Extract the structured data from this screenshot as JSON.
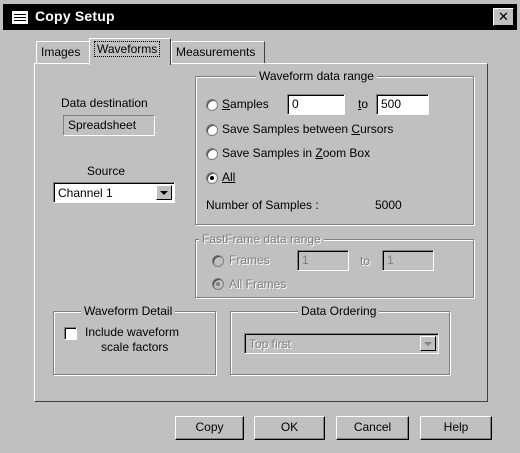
{
  "window": {
    "title": "Copy Setup",
    "close_glyph": "✕"
  },
  "tabs": [
    "Images",
    "Waveforms",
    "Measurements"
  ],
  "data_destination": {
    "label": "Data destination",
    "value": "Spreadsheet"
  },
  "source": {
    "label": "Source",
    "selected": "Channel 1"
  },
  "waveform_range": {
    "title": "Waveform data range",
    "samples_label": "Samples",
    "samples_from": "0",
    "to_label": "to",
    "samples_to": "500",
    "between_cursors_label": "Save Samples between Cursors",
    "zoom_box_label": "Save Samples in Zoom Box",
    "all_label": "All",
    "selected_option": "All",
    "num_samples_label": "Number of Samples :",
    "num_samples_value": "5000"
  },
  "fastframe": {
    "title": "FastFrame data range",
    "frames_label": "Frames",
    "frames_from": "1",
    "to_label": "to",
    "frames_to": "1",
    "all_frames_label": "All Frames",
    "selected_option": "All Frames"
  },
  "waveform_detail": {
    "title": "Waveform Detail",
    "checkbox_line1": "Include waveform",
    "checkbox_line2": "scale factors",
    "checked": false
  },
  "data_ordering": {
    "title": "Data Ordering",
    "selected": "Top first"
  },
  "buttons": {
    "copy": "Copy",
    "ok": "OK",
    "cancel": "Cancel",
    "help": "Help"
  },
  "colors": {
    "face": "#c0c0c0",
    "titlebar": "#000000",
    "disabled_text": "#808080"
  }
}
